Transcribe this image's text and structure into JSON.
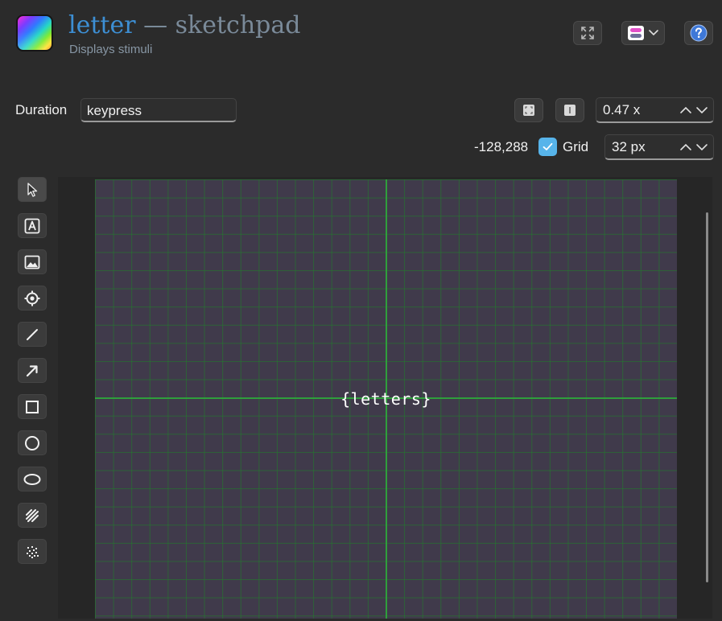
{
  "header": {
    "item_name": "letter",
    "separator": "—",
    "item_type": "sketchpad",
    "description": "Displays stimuli"
  },
  "duration": {
    "label": "Duration",
    "value": "keypress"
  },
  "view": {
    "zoom_value": "0.47 x",
    "coordinates": "-128,288",
    "grid_label": "Grid",
    "grid_enabled": true,
    "grid_size_value": "32 px"
  },
  "tools": [
    {
      "name": "select-tool",
      "icon": "cursor-arrow-icon"
    },
    {
      "name": "text-tool",
      "icon": "text-a-icon"
    },
    {
      "name": "image-tool",
      "icon": "image-icon"
    },
    {
      "name": "fixation-dot-tool",
      "icon": "fixation-dot-icon"
    },
    {
      "name": "line-tool",
      "icon": "line-icon"
    },
    {
      "name": "arrow-tool",
      "icon": "arrow-icon"
    },
    {
      "name": "rectangle-tool",
      "icon": "rectangle-icon"
    },
    {
      "name": "circle-tool",
      "icon": "circle-icon"
    },
    {
      "name": "ellipse-tool",
      "icon": "ellipse-icon"
    },
    {
      "name": "gabor-tool",
      "icon": "gabor-patch-icon"
    },
    {
      "name": "noise-patch-tool",
      "icon": "noise-patch-icon"
    }
  ],
  "canvas": {
    "text_element": "{letters}"
  },
  "colors": {
    "accent_blue": "#3d8fd4",
    "checkbox_blue": "#57b4ea",
    "canvas_background": "#403a4b",
    "grid_line": "#23782d",
    "axis_line": "#2f9e3c"
  }
}
